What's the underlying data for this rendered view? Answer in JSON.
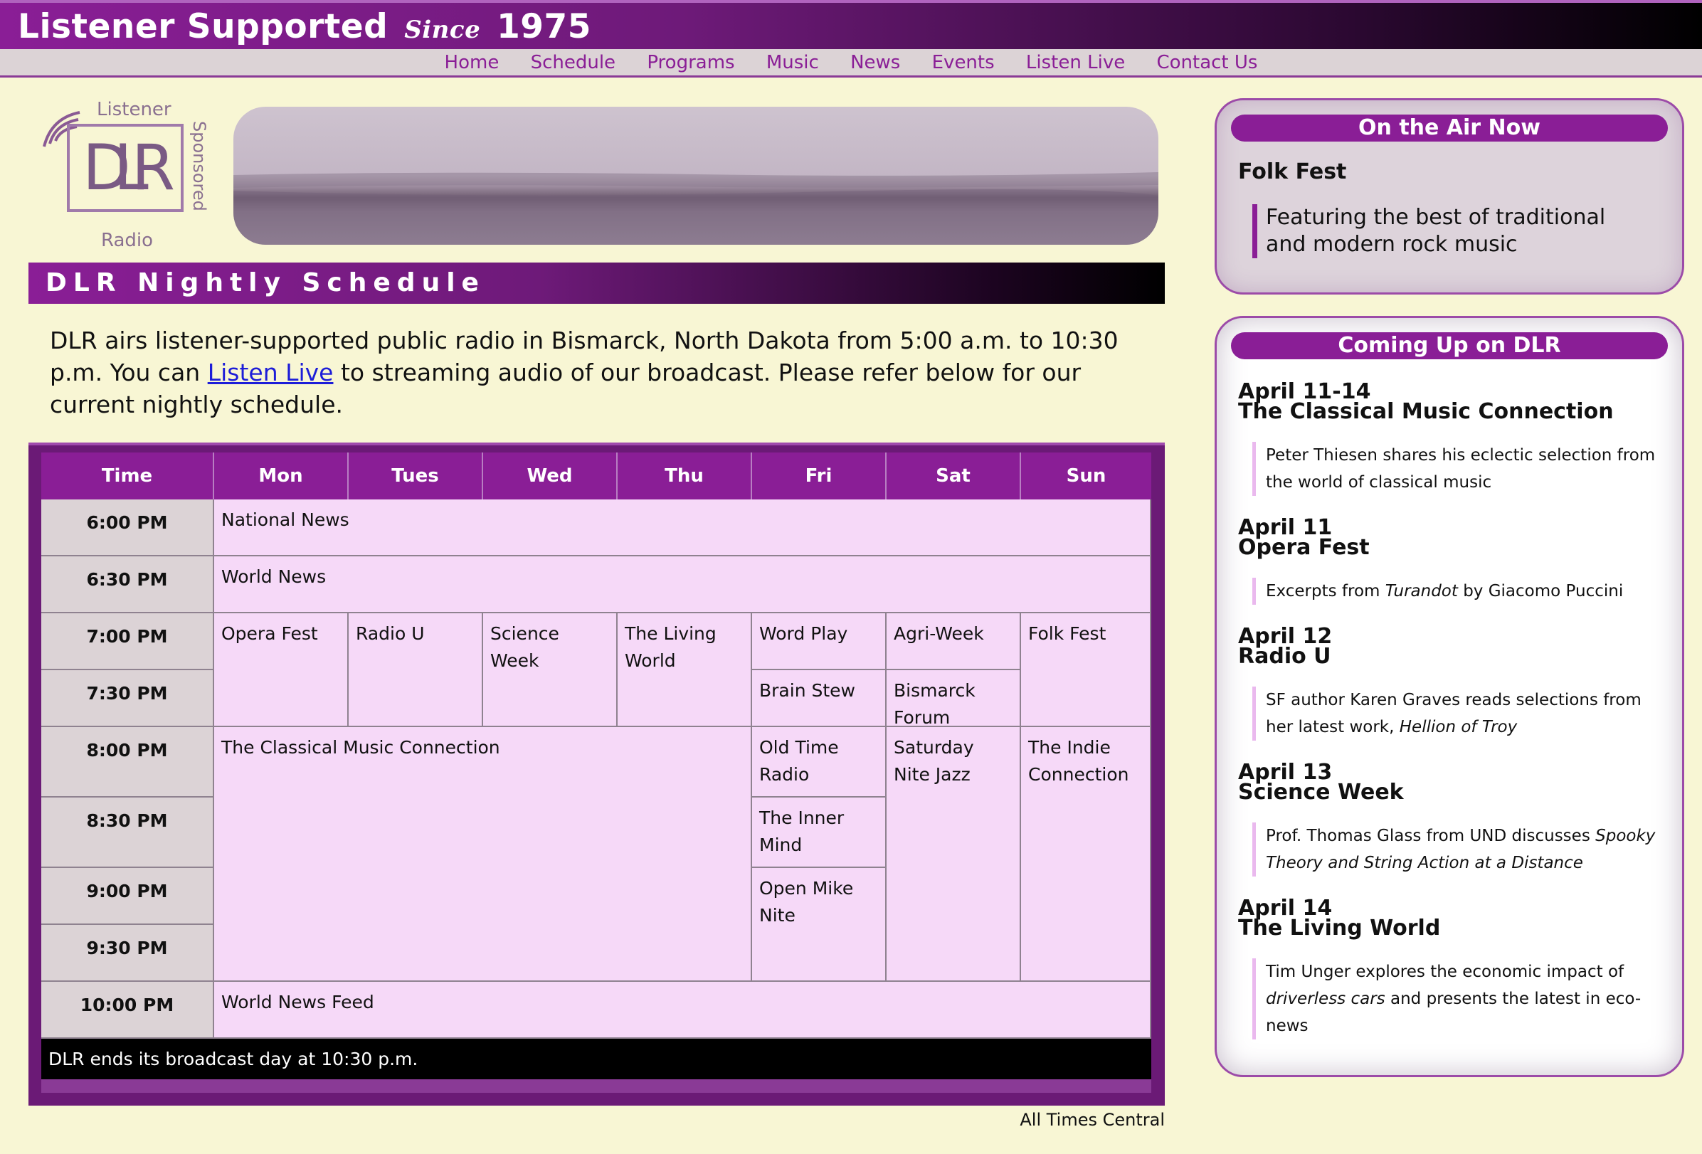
{
  "banner": {
    "title_part1": "Listener Supported",
    "title_since": "Since",
    "title_year": "1975"
  },
  "nav": [
    "Home",
    "Schedule",
    "Programs",
    "Music",
    "News",
    "Events",
    "Listen Live",
    "Contact Us"
  ],
  "logo": {
    "top": "Listener",
    "main": "DLR",
    "side": "Sponsored",
    "bottom": "Radio"
  },
  "section_title": "DLR Nightly Schedule",
  "intro": {
    "before_link": "DLR airs listener-supported public radio in Bismarck, North Dakota from 5:00 a.m. to 10:30 p.m. You can ",
    "link": "Listen Live",
    "after_link": " to streaming audio of our broadcast. Please refer below for our current nightly schedule."
  },
  "schedule": {
    "headers": [
      "Time",
      "Mon",
      "Tues",
      "Wed",
      "Thu",
      "Fri",
      "Sat",
      "Sun"
    ],
    "times": [
      "6:00 PM",
      "6:30 PM",
      "7:00 PM",
      "7:30 PM",
      "8:00 PM",
      "8:30 PM",
      "9:00 PM",
      "9:30 PM",
      "10:00 PM"
    ],
    "programs": {
      "national_news": "National News",
      "world_news": "World News",
      "opera_fest": "Opera Fest",
      "radio_u": "Radio U",
      "science_week": "Science Week",
      "living_world": "The Living World",
      "word_play": "Word Play",
      "agri_week": "Agri-Week",
      "folk_fest": "Folk Fest",
      "brain_stew": "Brain Stew",
      "bismarck_forum": "Bismarck Forum",
      "classical": "The Classical Music Connection",
      "old_time_radio": "Old Time Radio",
      "saturday_jazz": "Saturday Nite Jazz",
      "indie": "The Indie Connection",
      "inner_mind": "The Inner Mind",
      "open_mike": "Open Mike Nite",
      "world_news_feed": "World News Feed"
    },
    "footer": "DLR ends its broadcast day at 10:30 p.m.",
    "note": "All Times Central"
  },
  "on_air": {
    "title": "On the Air Now",
    "show": "Folk Fest",
    "description": "Featuring the best of traditional and modern rock music"
  },
  "coming_up": {
    "title": "Coming Up on DLR",
    "events": [
      {
        "date": "April 11-14",
        "name": "The Classical Music Connection",
        "desc_parts": [
          {
            "t": "Peter Thiesen shares his eclectic selection from the world of classical music",
            "i": false
          }
        ]
      },
      {
        "date": "April 11",
        "name": "Opera Fest",
        "desc_parts": [
          {
            "t": "Excerpts from ",
            "i": false
          },
          {
            "t": "Turandot",
            "i": true
          },
          {
            "t": " by Giacomo Puccini",
            "i": false
          }
        ]
      },
      {
        "date": "April 12",
        "name": "Radio U",
        "desc_parts": [
          {
            "t": "SF author Karen Graves reads selections from her latest work, ",
            "i": false
          },
          {
            "t": "Hellion of Troy",
            "i": true
          }
        ]
      },
      {
        "date": "April 13",
        "name": "Science Week",
        "desc_parts": [
          {
            "t": "Prof. Thomas Glass from UND discusses ",
            "i": false
          },
          {
            "t": "Spooky Theory and String Action at a Distance",
            "i": true
          }
        ]
      },
      {
        "date": "April 14",
        "name": "The Living World",
        "desc_parts": [
          {
            "t": "Tim Unger explores the economic impact of ",
            "i": false
          },
          {
            "t": "driverless cars",
            "i": true
          },
          {
            "t": " and presents the latest in eco-news",
            "i": false
          }
        ]
      }
    ]
  }
}
